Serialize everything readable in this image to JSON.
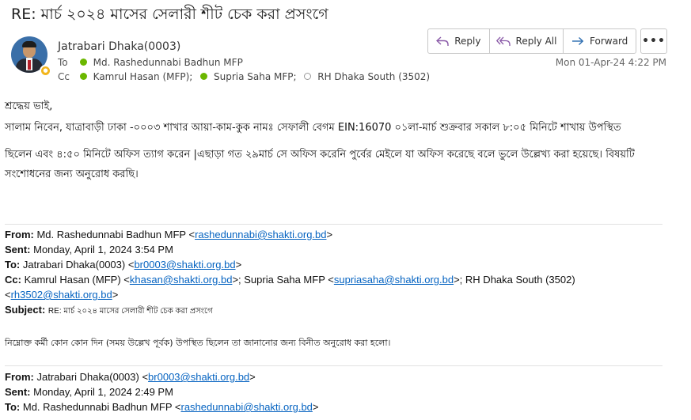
{
  "subject": "RE: মার্চ ২০২৪ মাসের সেলারী শীট চেক করা প্রসংগে",
  "message": {
    "sender": "Jatrabari Dhaka(0003)",
    "to_label": "To",
    "cc_label": "Cc",
    "to": "Md. Rashedunnabi Badhun MFP",
    "cc": [
      "Kamrul Hasan (MFP);",
      "Supria Saha MFP;",
      "RH Dhaka South (3502)"
    ],
    "date": "Mon 01-Apr-24 4:22 PM"
  },
  "actions": {
    "reply": "Reply",
    "reply_all": "Reply All",
    "forward": "Forward",
    "more": "•••"
  },
  "body": {
    "greeting": "শ্রদ্ধেয় ভাই,",
    "line1": "সালাম নিবেন, যাত্রাবাড়ী ঢাকা -০০০৩ শাখার আয়া-কাম-কুক নামঃ সেফালী বেগম  EIN:16070 ০১লা-মার্চ শুক্রবার সকাল ৮:০৫ মিনিটে শাখায় উপস্থিত",
    "line2": "ছিলেন  এবং ৪:৫০ মিনিটে অফিস ত্যাগ করেন |এছাড়া গত ২৯মার্চ সে অফিস করেনি পুর্বের মেইলে যা অফিস করেছে বলে  ভুলে উল্লেখ্য করা হয়েছে।  বিষয়টি",
    "line3": "সংশোধনের জন্য অনুরোধ করছি।"
  },
  "quoted1": {
    "from_label": "From:",
    "from_name": "Md. Rashedunnabi Badhun MFP",
    "from_email": "rashedunnabi@shakti.org.bd",
    "sent_label": "Sent:",
    "sent": "Monday, April 1, 2024 3:54 PM",
    "to_label": "To:",
    "to_name": "Jatrabari Dhaka(0003)",
    "to_email": "br0003@shakti.org.bd",
    "cc_label": "Cc:",
    "cc1_name": "Kamrul Hasan (MFP)",
    "cc1_email": "khasan@shakti.org.bd",
    "cc2_name": "Supria Saha MFP",
    "cc2_email": "supriasaha@shakti.org.bd",
    "cc3_name": "RH Dhaka South (3502)",
    "cc3_email": "rh3502@shakti.org.bd",
    "subject_label": "Subject:",
    "subject": "RE: মার্চ ২০২৪ মাসের সেলারী শীট চেক করা প্রসংগে",
    "body": "নিম্নোক্ত কর্মী কোন কোন দিন (সময় উল্লেখ পূর্বক) উপস্থিত ছিলেন তা জানানোর জন্য বিনীত অনুরোধ করা হলো।"
  },
  "quoted2": {
    "from_label": "From:",
    "from_name": "Jatrabari Dhaka(0003)",
    "from_email": "br0003@shakti.org.bd",
    "sent_label": "Sent:",
    "sent": "Monday, April 1, 2024 2:49 PM",
    "to_label": "To:",
    "to_name": "Md. Rashedunnabi Badhun MFP",
    "to_email": "rashedunnabi@shakti.org.bd"
  }
}
